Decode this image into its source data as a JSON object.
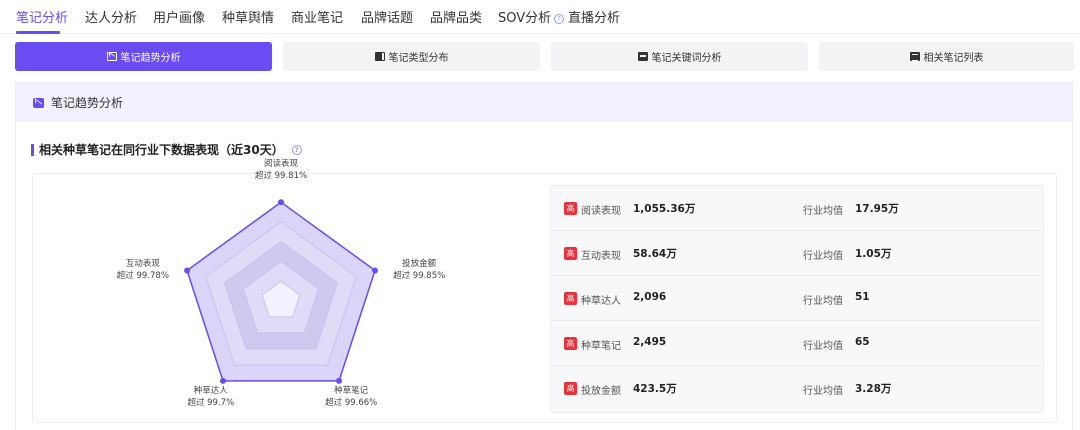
{
  "nav": {
    "tabs": [
      {
        "label": "笔记分析"
      },
      {
        "label": "达人分析"
      },
      {
        "label": "用户画像"
      },
      {
        "label": "种草舆情"
      },
      {
        "label": "商业笔记"
      },
      {
        "label": "品牌话题"
      },
      {
        "label": "品牌品类"
      },
      {
        "label": "SOV分析"
      },
      {
        "label": "直播分析"
      }
    ],
    "active_index": 0,
    "help_icon": "?"
  },
  "subtabs": [
    {
      "label": "笔记趋势分析",
      "icon": "chart-trend-icon"
    },
    {
      "label": "笔记类型分布",
      "icon": "book-icon"
    },
    {
      "label": "笔记关键词分析",
      "icon": "message-icon"
    },
    {
      "label": "相关笔记列表",
      "icon": "list-icon"
    }
  ],
  "panel": {
    "title": "笔记趋势分析",
    "section_title": "相关种草笔记在同行业下数据表现（近30天）",
    "section_help": "?"
  },
  "radar": {
    "axes": [
      {
        "name": "阅读表现",
        "sub": "超过 99.81%",
        "value": 99.81
      },
      {
        "name": "投放金额",
        "sub": "超过 99.85%",
        "value": 99.85
      },
      {
        "name": "种草笔记",
        "sub": "超过 99.66%",
        "value": 99.66
      },
      {
        "name": "种草达人",
        "sub": "超过 99.7%",
        "value": 99.7
      },
      {
        "name": "互动表现",
        "sub": "超过 99.78%",
        "value": 99.78
      }
    ],
    "colors": {
      "line": "#6a4cf2",
      "fill": "#e6e1fb",
      "grid_dark": "#d9d4ef",
      "grid_light": "#ebe8f7"
    }
  },
  "metrics": [
    {
      "badge": "高",
      "name": "阅读表现",
      "value": "1,055.36万",
      "avg_label": "行业均值",
      "avg": "17.95万"
    },
    {
      "badge": "高",
      "name": "互动表现",
      "value": "58.64万",
      "avg_label": "行业均值",
      "avg": "1.05万"
    },
    {
      "badge": "高",
      "name": "种草达人",
      "value": "2,096",
      "avg_label": "行业均值",
      "avg": "51"
    },
    {
      "badge": "高",
      "name": "种草笔记",
      "value": "2,495",
      "avg_label": "行业均值",
      "avg": "65"
    },
    {
      "badge": "高",
      "name": "投放金额",
      "value": "423.5万",
      "avg_label": "行业均值",
      "avg": "3.28万"
    }
  ]
}
